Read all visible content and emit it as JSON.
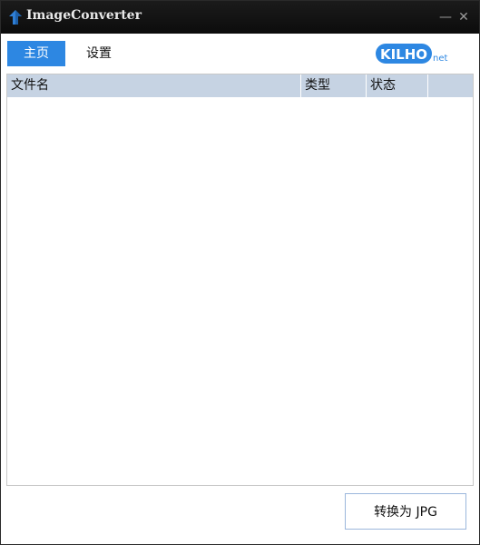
{
  "window": {
    "title": "ImageConverter",
    "minimize_glyph": "—",
    "close_glyph": "✕"
  },
  "tabs": [
    {
      "label": "主页",
      "active": true
    },
    {
      "label": "设置",
      "active": false
    }
  ],
  "logo": {
    "text": "KILHO",
    "suffix": "net",
    "color": "#2d87e2"
  },
  "file_list": {
    "columns": [
      "文件名",
      "类型",
      "状态",
      ""
    ],
    "rows": []
  },
  "actions": {
    "convert_label": "转换为 JPG"
  },
  "colors": {
    "accent": "#2d87e2",
    "header_bg": "#c6d3e3",
    "titlebar_bg": "#111111"
  },
  "icons": {
    "app": "arrow-up-icon"
  }
}
